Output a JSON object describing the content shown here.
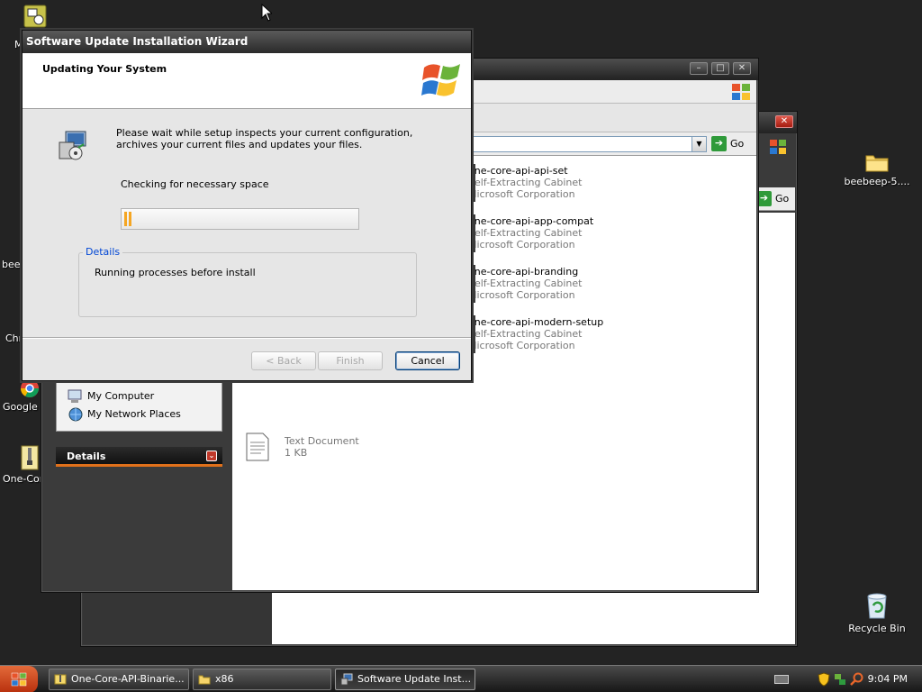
{
  "desktop": {
    "icons": [
      {
        "name": "my-icon-top-left",
        "label": "M"
      },
      {
        "name": "beebeep-desktop-left",
        "label": "bee"
      },
      {
        "name": "chrome-desktop-left",
        "label": "Chr"
      },
      {
        "name": "google-chrome-shortcut",
        "label": "Google C"
      },
      {
        "name": "one-core-shortcut",
        "label": "One-Cor"
      },
      {
        "name": "beebeep-folder",
        "label": "beebeep-5...."
      },
      {
        "name": "recycle-bin",
        "label": "Recycle Bin"
      }
    ]
  },
  "explorer": {
    "address_go": "Go",
    "back_window_go": "Go",
    "files": [
      {
        "name": "one-core-api-api-set",
        "type": "Self-Extracting Cabinet",
        "company": "Microsoft Corporation"
      },
      {
        "name": "one-core-api-app-compat",
        "type": "Self-Extracting Cabinet",
        "company": "Microsoft Corporation"
      },
      {
        "name": "one-core-api-branding",
        "type": "Self-Extracting Cabinet",
        "company": "Microsoft Corporation"
      },
      {
        "name": "one-core-api-modern-setup",
        "type": "Self-Extracting Cabinet",
        "company": "Microsoft Corporation"
      }
    ],
    "text_doc": {
      "type": "Text Document",
      "size": "1 KB"
    },
    "other_places": [
      "My Computer",
      "My Network Places"
    ],
    "details_header": "Details"
  },
  "wizard": {
    "title": "Software Update Installation Wizard",
    "heading": "Updating Your System",
    "description": "Please wait while setup inspects your current configuration, archives your current files and updates your files.",
    "status": "Checking for necessary space",
    "progress_percent": 3,
    "details_label": "Details",
    "details_text": "Running processes before install",
    "buttons": {
      "back": "< Back",
      "finish": "Finish",
      "cancel": "Cancel"
    }
  },
  "taskbar": {
    "items": [
      {
        "label": "One-Core-API-Binarie..."
      },
      {
        "label": "x86"
      },
      {
        "label": "Software Update Inst..."
      }
    ],
    "clock": "9:04 PM"
  },
  "colors": {
    "accent_orange": "#e0701a",
    "progress_orange": "#f5a623",
    "start_button": "#c9441a"
  }
}
